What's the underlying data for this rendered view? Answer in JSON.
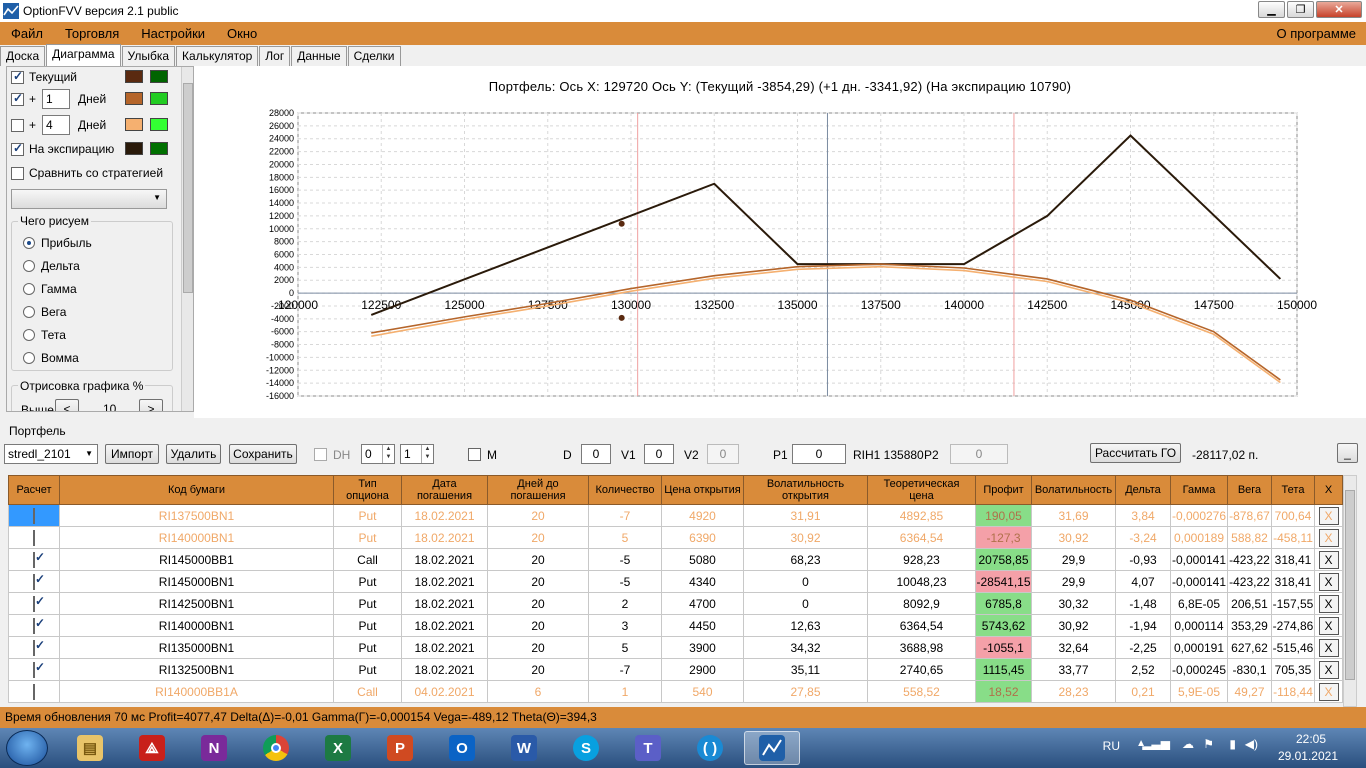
{
  "window": {
    "title": "OptionFVV версия 2.1 public"
  },
  "menu": {
    "items": [
      "Файл",
      "Торговля",
      "Настройки",
      "Окно"
    ],
    "about": "О программе"
  },
  "tabs": [
    "Доска",
    "Диаграмма",
    "Улыбка",
    "Калькулятор",
    "Лог",
    "Данные",
    "Сделки"
  ],
  "left_panel": {
    "current_label": "Текущий",
    "plus_label": "+",
    "days_label": "Дней",
    "days1": "1",
    "days2": "4",
    "expiration_label": "На экспирацию",
    "compare_label": "Сравнить со стратегией",
    "draw_group": "Чего рисуем",
    "radios": [
      "Прибыль",
      "Дельта",
      "Гамма",
      "Вега",
      "Тета",
      "Вомма"
    ],
    "draw_percent_label": "Отрисовка графика %",
    "above_label": "Выше",
    "above_value": "10",
    "dec": "<",
    "inc": ">",
    "colors": {
      "current": [
        "#5a2a10",
        "#006400"
      ],
      "plus1": [
        "#b5652a",
        "#22cc22"
      ],
      "plus4": [
        "#f5b070",
        "#33ff33"
      ],
      "expiration": [
        "#2a1a0a",
        "#007000"
      ]
    }
  },
  "chart_header": "Портфель:  Ось X:  129720  Ось Y:   (Текущий -3854,29)  (+1 дн. -3341,92)  (На экспирацию 10790)",
  "chart_data": {
    "type": "line",
    "x_ticks": [
      120000,
      122500,
      125000,
      127500,
      130000,
      132500,
      135000,
      137500,
      140000,
      142500,
      145000,
      147500,
      150000
    ],
    "y_ticks": [
      28000,
      26000,
      24000,
      22000,
      20000,
      18000,
      16000,
      14000,
      12000,
      10000,
      8000,
      6000,
      4000,
      2000,
      0,
      -2000,
      -4000,
      -6000,
      -8000,
      -10000,
      -12000,
      -14000,
      -16000
    ],
    "xlim": [
      120000,
      150000
    ],
    "ylim": [
      -16000,
      28000
    ],
    "grid": true,
    "series": [
      {
        "points": [
          [
            122200,
            -3400
          ],
          [
            132500,
            17000
          ],
          [
            135000,
            4500
          ],
          [
            140000,
            4500
          ],
          [
            142500,
            12000
          ],
          [
            145000,
            24500
          ],
          [
            149500,
            2200
          ]
        ],
        "color": "#2a1a0a"
      },
      {
        "points": [
          [
            122200,
            -6200
          ],
          [
            125000,
            -3700
          ],
          [
            127500,
            -1600
          ],
          [
            130000,
            700
          ],
          [
            132500,
            2700
          ],
          [
            135000,
            4100
          ],
          [
            137500,
            4500
          ],
          [
            140000,
            3900
          ],
          [
            142500,
            2200
          ],
          [
            145000,
            -1100
          ],
          [
            147500,
            -6000
          ],
          [
            149500,
            -13500
          ]
        ],
        "color": "#b5652a"
      },
      {
        "points": [
          [
            122200,
            -6700
          ],
          [
            125000,
            -4100
          ],
          [
            127500,
            -2000
          ],
          [
            130000,
            300
          ],
          [
            132500,
            2300
          ],
          [
            135000,
            3700
          ],
          [
            137500,
            4100
          ],
          [
            140000,
            3500
          ],
          [
            142500,
            1800
          ],
          [
            145000,
            -1500
          ],
          [
            147500,
            -6400
          ],
          [
            149500,
            -13900
          ]
        ],
        "color": "#f5b070"
      }
    ],
    "markers": [
      [
        129720,
        10790
      ],
      [
        129720,
        -3854
      ]
    ],
    "vlines": [
      {
        "x": 135900,
        "color": "#7a8aa0"
      },
      {
        "x": 130200,
        "color": "#f0a0a0"
      },
      {
        "x": 141500,
        "color": "#f0a0a0"
      }
    ]
  },
  "portfolio": {
    "label": "Портфель",
    "combo": "stredl_2101",
    "import": "Импорт",
    "delete": "Удалить",
    "save": "Сохранить",
    "dh": "DH",
    "spin1": "0",
    "spin2": "1",
    "m": "M",
    "d": "D",
    "d_val": "0",
    "v1": "V1",
    "v1_val": "0",
    "v2": "V2",
    "v2_val": "0",
    "p1": "P1",
    "p1_val": "0",
    "rih": "RIH1 135880",
    "p2": "P2",
    "p2_val": "0",
    "calc_go": "Рассчитать ГО",
    "go_value": "-28117,02 п.",
    "minimize": "_"
  },
  "table": {
    "headers": [
      "Расчет",
      "Код бумаги",
      "Тип опциона",
      "Дата погашения",
      "Дней до погашения",
      "Количество",
      "Цена открытия",
      "Волатильность открытия",
      "Теоретическая цена",
      "Профит",
      "Волатильность",
      "Дельта",
      "Гамма",
      "Вега",
      "Тета",
      "X"
    ],
    "rows": [
      {
        "checked": false,
        "dim": true,
        "cells": [
          "RI137500BN1",
          "Put",
          "18.02.2021",
          "20",
          "-7",
          "4920",
          "31,91",
          "4892,85",
          "190,05",
          "31,69",
          "3,84",
          "-0,000276",
          "-878,67",
          "700,64"
        ],
        "profit_color": "#88dd88"
      },
      {
        "checked": false,
        "dim": true,
        "cells": [
          "RI140000BN1",
          "Put",
          "18.02.2021",
          "20",
          "5",
          "6390",
          "30,92",
          "6364,54",
          "-127,3",
          "30,92",
          "-3,24",
          "0,000189",
          "588,82",
          "-458,11"
        ],
        "profit_color": "#f4a0a8"
      },
      {
        "checked": true,
        "dim": false,
        "cells": [
          "RI145000BB1",
          "Call",
          "18.02.2021",
          "20",
          "-5",
          "5080",
          "68,23",
          "928,23",
          "20758,85",
          "29,9",
          "-0,93",
          "-0,000141",
          "-423,22",
          "318,41"
        ],
        "profit_color": "#88dd88"
      },
      {
        "checked": true,
        "dim": false,
        "cells": [
          "RI145000BN1",
          "Put",
          "18.02.2021",
          "20",
          "-5",
          "4340",
          "0",
          "10048,23",
          "-28541,15",
          "29,9",
          "4,07",
          "-0,000141",
          "-423,22",
          "318,41"
        ],
        "profit_color": "#f4a0a8"
      },
      {
        "checked": true,
        "dim": false,
        "cells": [
          "RI142500BN1",
          "Put",
          "18.02.2021",
          "20",
          "2",
          "4700",
          "0",
          "8092,9",
          "6785,8",
          "30,32",
          "-1,48",
          "6,8E-05",
          "206,51",
          "-157,55"
        ],
        "profit_color": "#88dd88"
      },
      {
        "checked": true,
        "dim": false,
        "cells": [
          "RI140000BN1",
          "Put",
          "18.02.2021",
          "20",
          "3",
          "4450",
          "12,63",
          "6364,54",
          "5743,62",
          "30,92",
          "-1,94",
          "0,000114",
          "353,29",
          "-274,86"
        ],
        "profit_color": "#88dd88"
      },
      {
        "checked": true,
        "dim": false,
        "cells": [
          "RI135000BN1",
          "Put",
          "18.02.2021",
          "20",
          "5",
          "3900",
          "34,32",
          "3688,98",
          "-1055,1",
          "32,64",
          "-2,25",
          "0,000191",
          "627,62",
          "-515,46"
        ],
        "profit_color": "#f4a0a8"
      },
      {
        "checked": true,
        "dim": false,
        "cells": [
          "RI132500BN1",
          "Put",
          "18.02.2021",
          "20",
          "-7",
          "2900",
          "35,11",
          "2740,65",
          "1115,45",
          "33,77",
          "2,52",
          "-0,000245",
          "-830,1",
          "705,35"
        ],
        "profit_color": "#88dd88"
      },
      {
        "checked": false,
        "dim": true,
        "cells": [
          "RI140000BB1A",
          "Call",
          "04.02.2021",
          "6",
          "1",
          "540",
          "27,85",
          "558,52",
          "18,52",
          "28,23",
          "0,21",
          "5,9E-05",
          "49,27",
          "-118,44"
        ],
        "profit_color": "#88dd88"
      }
    ],
    "x_label": "X"
  },
  "status": "Время обновления 70 мс  Profit=4077,47 Delta(Δ)=-0,01 Gamma(Γ)=-0,000154 Vega=-489,12 Theta(Θ)=394,3",
  "taskbar": {
    "lang": "RU",
    "time": "22:05",
    "date": "29.01.2021"
  }
}
